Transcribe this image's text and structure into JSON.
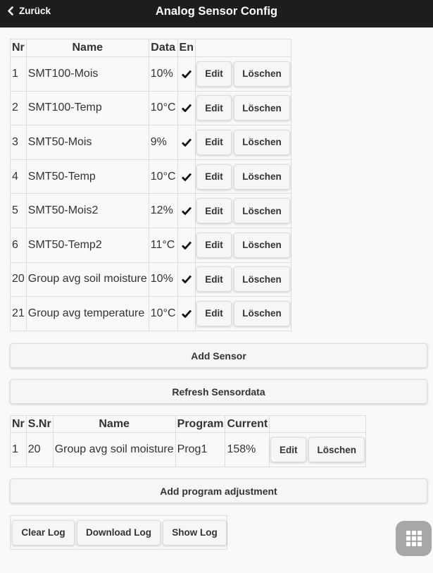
{
  "header": {
    "back_label": "Zurück",
    "title": "Analog Sensor Config"
  },
  "sensor_table": {
    "columns": [
      "Nr",
      "Name",
      "Data",
      "En"
    ],
    "rows": [
      {
        "nr": "1",
        "name": "SMT100-Mois",
        "data": "10%",
        "enabled": true
      },
      {
        "nr": "2",
        "name": "SMT100-Temp",
        "data": "10°C",
        "enabled": true
      },
      {
        "nr": "3",
        "name": "SMT50-Mois",
        "data": "9%",
        "enabled": true
      },
      {
        "nr": "4",
        "name": "SMT50-Temp",
        "data": "10°C",
        "enabled": true
      },
      {
        "nr": "5",
        "name": "SMT50-Mois2",
        "data": "12%",
        "enabled": true
      },
      {
        "nr": "6",
        "name": "SMT50-Temp2",
        "data": "11°C",
        "enabled": true
      },
      {
        "nr": "20",
        "name": "Group avg soil moisture",
        "data": "10%",
        "enabled": true
      },
      {
        "nr": "21",
        "name": "Group avg temperature",
        "data": "10°C",
        "enabled": true
      }
    ],
    "edit_label": "Edit",
    "delete_label": "Löschen"
  },
  "actions": {
    "add_sensor": "Add Sensor",
    "refresh_sensordata": "Refresh Sensordata",
    "add_program_adjustment": "Add program adjustment"
  },
  "program_table": {
    "columns": [
      "Nr",
      "S.Nr",
      "Name",
      "Program",
      "Current"
    ],
    "rows": [
      {
        "nr": "1",
        "snr": "20",
        "name": "Group avg soil moisture",
        "program": "Prog1",
        "current": "158%"
      }
    ],
    "edit_label": "Edit",
    "delete_label": "Löschen"
  },
  "log": {
    "clear": "Clear Log",
    "download": "Download Log",
    "show": "Show Log"
  },
  "icons": {
    "back": "chevron-left-icon",
    "check": "checkmark-icon",
    "menu": "grid-menu-icon"
  },
  "colors": {
    "header_bg": "#1d1d1d",
    "page_bg": "#f9f9f9",
    "button_bg": "#f6f6f6",
    "fab_bg": "#9a9a9a"
  }
}
